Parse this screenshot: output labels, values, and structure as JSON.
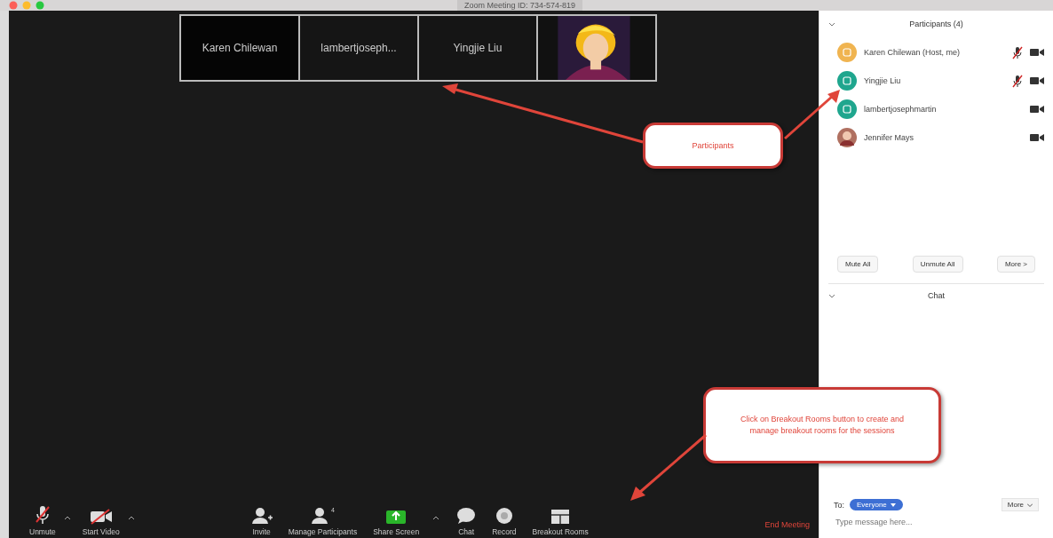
{
  "window": {
    "title": "Zoom Meeting ID: 734-574-819"
  },
  "video_strip": [
    {
      "kind": "name",
      "label": "Karen Chilewan"
    },
    {
      "kind": "name",
      "label": "lambertjoseph..."
    },
    {
      "kind": "name",
      "label": "Yingjie Liu"
    },
    {
      "kind": "picture"
    }
  ],
  "toolbar": {
    "items": [
      {
        "label": "Unmute",
        "kind": "mic",
        "caret": true
      },
      {
        "label": "Start Video",
        "kind": "video",
        "caret": true
      },
      {
        "label": "Invite",
        "kind": "invite",
        "caret": false
      },
      {
        "label": "Manage Participants",
        "kind": "participants",
        "caret": false,
        "count": "4"
      },
      {
        "label": "Share Screen",
        "kind": "share",
        "caret": true
      },
      {
        "label": "Chat",
        "kind": "chat",
        "caret": false
      },
      {
        "label": "Record",
        "kind": "record",
        "caret": false
      },
      {
        "label": "Breakout Rooms",
        "kind": "rooms",
        "caret": false
      }
    ],
    "end_button": "End Meeting"
  },
  "participants": {
    "title": "Participants (4)",
    "list": [
      {
        "name": "Karen Chilewan (Host, me)",
        "kind": "initials",
        "color": "#f0b450",
        "mic_muted": true
      },
      {
        "name": "Yingjie Liu",
        "kind": "initials",
        "color": "#1fa68e",
        "mic_muted": true
      },
      {
        "name": "lambertjosephmartin",
        "kind": "initials",
        "color": "#1fa68e",
        "mic_muted": false
      },
      {
        "name": "Jennifer Mays",
        "kind": "picture",
        "mic_muted": false
      }
    ],
    "buttons": [
      "Mute All",
      "Unmute All",
      "More >"
    ]
  },
  "chat": {
    "title": "Chat",
    "to_label": "To:",
    "recipient": "Everyone",
    "more": "More",
    "placeholder": "Type message here..."
  },
  "callouts": [
    {
      "text": "Participants"
    },
    {
      "text": "Click on Breakout Rooms button to create and manage breakout rooms for the sessions"
    }
  ]
}
